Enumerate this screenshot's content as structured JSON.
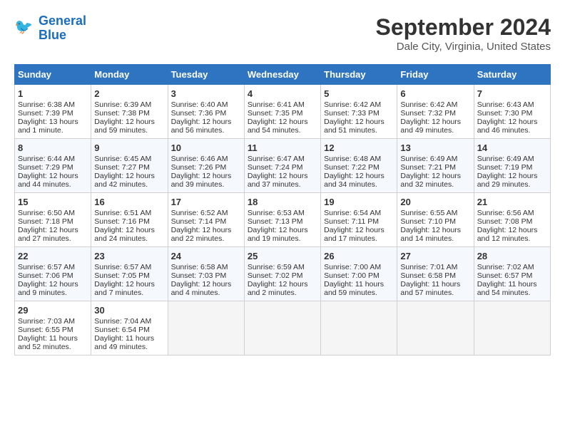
{
  "header": {
    "logo_line1": "General",
    "logo_line2": "Blue",
    "title": "September 2024",
    "subtitle": "Dale City, Virginia, United States"
  },
  "days_of_week": [
    "Sunday",
    "Monday",
    "Tuesday",
    "Wednesday",
    "Thursday",
    "Friday",
    "Saturday"
  ],
  "weeks": [
    [
      {
        "day": "1",
        "sunrise": "Sunrise: 6:38 AM",
        "sunset": "Sunset: 7:39 PM",
        "daylight": "Daylight: 13 hours and 1 minute."
      },
      {
        "day": "2",
        "sunrise": "Sunrise: 6:39 AM",
        "sunset": "Sunset: 7:38 PM",
        "daylight": "Daylight: 12 hours and 59 minutes."
      },
      {
        "day": "3",
        "sunrise": "Sunrise: 6:40 AM",
        "sunset": "Sunset: 7:36 PM",
        "daylight": "Daylight: 12 hours and 56 minutes."
      },
      {
        "day": "4",
        "sunrise": "Sunrise: 6:41 AM",
        "sunset": "Sunset: 7:35 PM",
        "daylight": "Daylight: 12 hours and 54 minutes."
      },
      {
        "day": "5",
        "sunrise": "Sunrise: 6:42 AM",
        "sunset": "Sunset: 7:33 PM",
        "daylight": "Daylight: 12 hours and 51 minutes."
      },
      {
        "day": "6",
        "sunrise": "Sunrise: 6:42 AM",
        "sunset": "Sunset: 7:32 PM",
        "daylight": "Daylight: 12 hours and 49 minutes."
      },
      {
        "day": "7",
        "sunrise": "Sunrise: 6:43 AM",
        "sunset": "Sunset: 7:30 PM",
        "daylight": "Daylight: 12 hours and 46 minutes."
      }
    ],
    [
      {
        "day": "8",
        "sunrise": "Sunrise: 6:44 AM",
        "sunset": "Sunset: 7:29 PM",
        "daylight": "Daylight: 12 hours and 44 minutes."
      },
      {
        "day": "9",
        "sunrise": "Sunrise: 6:45 AM",
        "sunset": "Sunset: 7:27 PM",
        "daylight": "Daylight: 12 hours and 42 minutes."
      },
      {
        "day": "10",
        "sunrise": "Sunrise: 6:46 AM",
        "sunset": "Sunset: 7:26 PM",
        "daylight": "Daylight: 12 hours and 39 minutes."
      },
      {
        "day": "11",
        "sunrise": "Sunrise: 6:47 AM",
        "sunset": "Sunset: 7:24 PM",
        "daylight": "Daylight: 12 hours and 37 minutes."
      },
      {
        "day": "12",
        "sunrise": "Sunrise: 6:48 AM",
        "sunset": "Sunset: 7:22 PM",
        "daylight": "Daylight: 12 hours and 34 minutes."
      },
      {
        "day": "13",
        "sunrise": "Sunrise: 6:49 AM",
        "sunset": "Sunset: 7:21 PM",
        "daylight": "Daylight: 12 hours and 32 minutes."
      },
      {
        "day": "14",
        "sunrise": "Sunrise: 6:49 AM",
        "sunset": "Sunset: 7:19 PM",
        "daylight": "Daylight: 12 hours and 29 minutes."
      }
    ],
    [
      {
        "day": "15",
        "sunrise": "Sunrise: 6:50 AM",
        "sunset": "Sunset: 7:18 PM",
        "daylight": "Daylight: 12 hours and 27 minutes."
      },
      {
        "day": "16",
        "sunrise": "Sunrise: 6:51 AM",
        "sunset": "Sunset: 7:16 PM",
        "daylight": "Daylight: 12 hours and 24 minutes."
      },
      {
        "day": "17",
        "sunrise": "Sunrise: 6:52 AM",
        "sunset": "Sunset: 7:14 PM",
        "daylight": "Daylight: 12 hours and 22 minutes."
      },
      {
        "day": "18",
        "sunrise": "Sunrise: 6:53 AM",
        "sunset": "Sunset: 7:13 PM",
        "daylight": "Daylight: 12 hours and 19 minutes."
      },
      {
        "day": "19",
        "sunrise": "Sunrise: 6:54 AM",
        "sunset": "Sunset: 7:11 PM",
        "daylight": "Daylight: 12 hours and 17 minutes."
      },
      {
        "day": "20",
        "sunrise": "Sunrise: 6:55 AM",
        "sunset": "Sunset: 7:10 PM",
        "daylight": "Daylight: 12 hours and 14 minutes."
      },
      {
        "day": "21",
        "sunrise": "Sunrise: 6:56 AM",
        "sunset": "Sunset: 7:08 PM",
        "daylight": "Daylight: 12 hours and 12 minutes."
      }
    ],
    [
      {
        "day": "22",
        "sunrise": "Sunrise: 6:57 AM",
        "sunset": "Sunset: 7:06 PM",
        "daylight": "Daylight: 12 hours and 9 minutes."
      },
      {
        "day": "23",
        "sunrise": "Sunrise: 6:57 AM",
        "sunset": "Sunset: 7:05 PM",
        "daylight": "Daylight: 12 hours and 7 minutes."
      },
      {
        "day": "24",
        "sunrise": "Sunrise: 6:58 AM",
        "sunset": "Sunset: 7:03 PM",
        "daylight": "Daylight: 12 hours and 4 minutes."
      },
      {
        "day": "25",
        "sunrise": "Sunrise: 6:59 AM",
        "sunset": "Sunset: 7:02 PM",
        "daylight": "Daylight: 12 hours and 2 minutes."
      },
      {
        "day": "26",
        "sunrise": "Sunrise: 7:00 AM",
        "sunset": "Sunset: 7:00 PM",
        "daylight": "Daylight: 11 hours and 59 minutes."
      },
      {
        "day": "27",
        "sunrise": "Sunrise: 7:01 AM",
        "sunset": "Sunset: 6:58 PM",
        "daylight": "Daylight: 11 hours and 57 minutes."
      },
      {
        "day": "28",
        "sunrise": "Sunrise: 7:02 AM",
        "sunset": "Sunset: 6:57 PM",
        "daylight": "Daylight: 11 hours and 54 minutes."
      }
    ],
    [
      {
        "day": "29",
        "sunrise": "Sunrise: 7:03 AM",
        "sunset": "Sunset: 6:55 PM",
        "daylight": "Daylight: 11 hours and 52 minutes."
      },
      {
        "day": "30",
        "sunrise": "Sunrise: 7:04 AM",
        "sunset": "Sunset: 6:54 PM",
        "daylight": "Daylight: 11 hours and 49 minutes."
      },
      null,
      null,
      null,
      null,
      null
    ]
  ]
}
